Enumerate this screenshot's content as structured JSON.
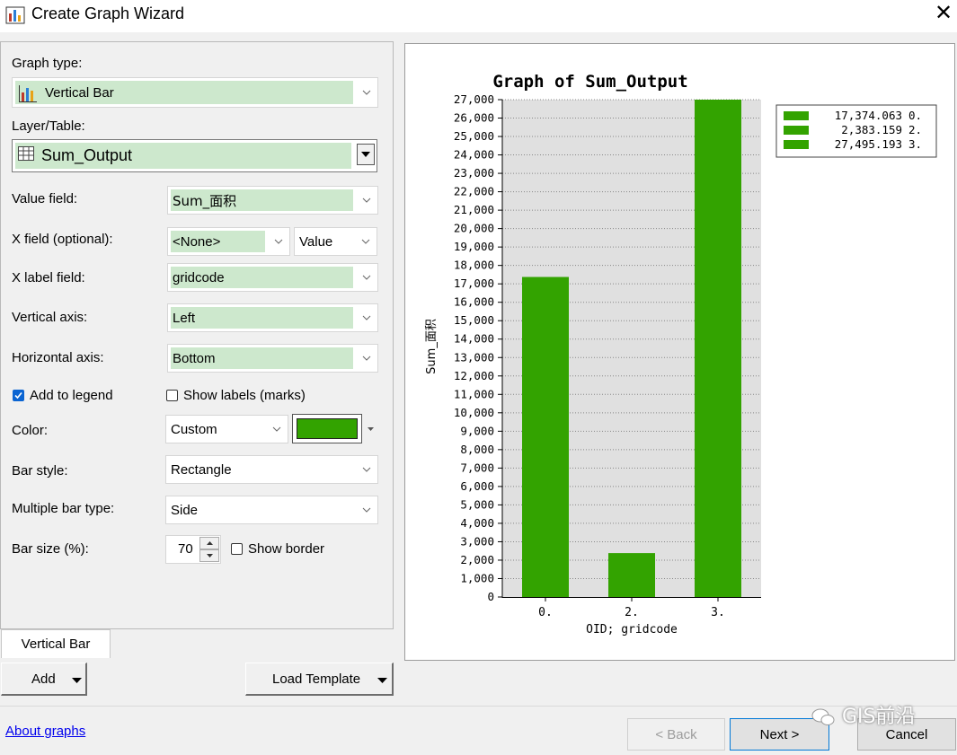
{
  "window": {
    "title": "Create Graph Wizard"
  },
  "form": {
    "graph_type_label": "Graph type:",
    "graph_type_value": "Vertical Bar",
    "layer_label": "Layer/Table:",
    "layer_value": "Sum_Output",
    "value_field_label": "Value field:",
    "value_field_value": "Sum_面积",
    "x_field_label": "X field (optional):",
    "x_field_value": "<None>",
    "x_field_sort": "Value",
    "x_label_field_label": "X label field:",
    "x_label_field_value": "gridcode",
    "vertical_axis_label": "Vertical axis:",
    "vertical_axis_value": "Left",
    "horizontal_axis_label": "Horizontal axis:",
    "horizontal_axis_value": "Bottom",
    "add_to_legend_label": "Add to legend",
    "add_to_legend_checked": true,
    "show_labels_label": "Show labels (marks)",
    "show_labels_checked": false,
    "color_label": "Color:",
    "color_mode": "Custom",
    "color_swatch": "#33a300",
    "bar_style_label": "Bar style:",
    "bar_style_value": "Rectangle",
    "multiple_bar_label": "Multiple bar type:",
    "multiple_bar_value": "Side",
    "bar_size_label": "Bar size (%):",
    "bar_size_value": "70",
    "show_border_label": "Show border",
    "show_border_checked": false
  },
  "tabs": {
    "active": "Vertical Bar"
  },
  "buttons": {
    "add": "Add",
    "load_template": "Load Template",
    "about": "About graphs",
    "back": "< Back",
    "next": "Next >",
    "cancel": "Cancel"
  },
  "watermark": "GIS前沿",
  "chart_data": {
    "type": "bar",
    "title": "Graph of Sum_Output",
    "xlabel": "OID; gridcode",
    "ylabel": "Sum_面积",
    "categories": [
      "0.",
      "2.",
      "3."
    ],
    "values": [
      17374.063,
      2383.159,
      27495.193
    ],
    "ylim": [
      0,
      27000
    ],
    "yticks": [
      "0",
      "1,000",
      "2,000",
      "3,000",
      "4,000",
      "5,000",
      "6,000",
      "7,000",
      "8,000",
      "9,000",
      "10,000",
      "11,000",
      "12,000",
      "13,000",
      "14,000",
      "15,000",
      "16,000",
      "17,000",
      "18,000",
      "19,000",
      "20,000",
      "21,000",
      "22,000",
      "23,000",
      "24,000",
      "25,000",
      "26,000",
      "27,000"
    ],
    "bar_color": "#33a300",
    "grid": true,
    "legend_position": "top-right",
    "legend": [
      {
        "value": "17,374.063",
        "label": "0."
      },
      {
        "value": "2,383.159",
        "label": "2."
      },
      {
        "value": "27,495.193",
        "label": "3."
      }
    ]
  }
}
